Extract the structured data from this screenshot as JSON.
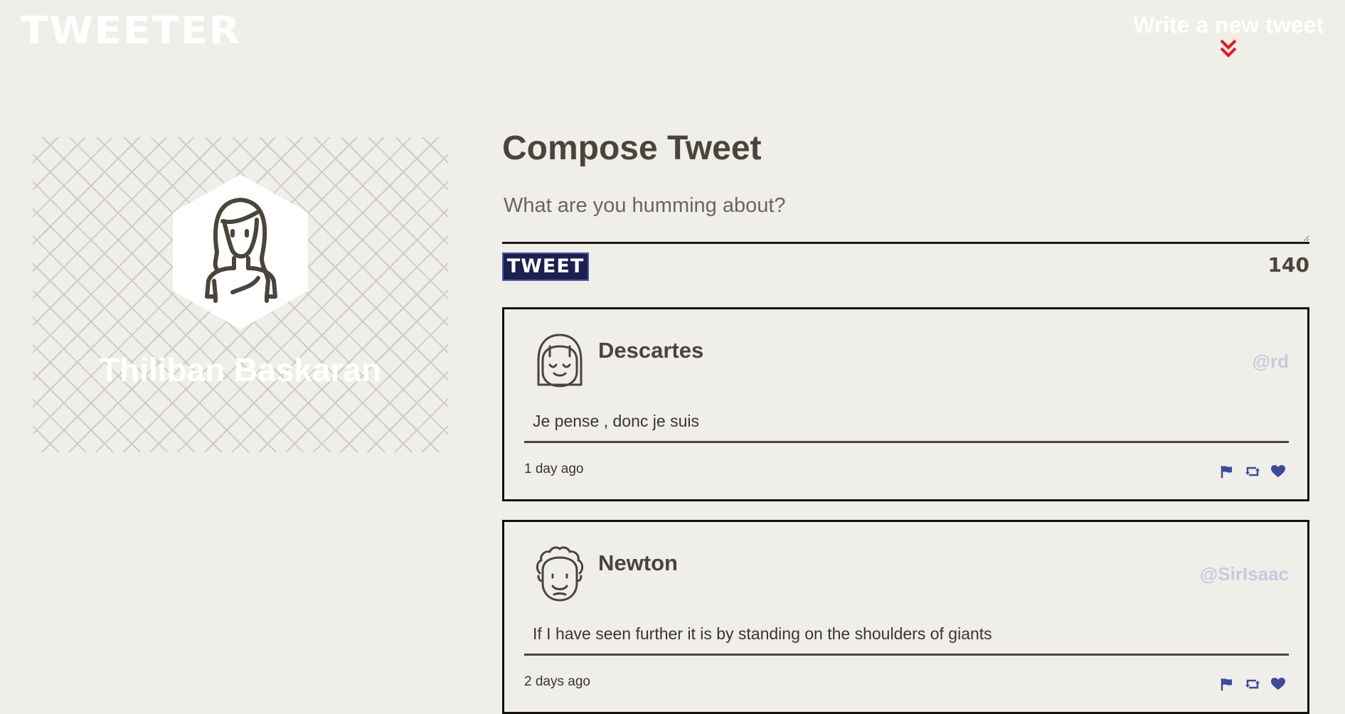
{
  "nav": {
    "logo": "TWEETER",
    "write_new_label": "Write a new tweet",
    "write_new_icon": "double-chevron-down-icon",
    "write_new_icon_color": "#e8141c"
  },
  "profile": {
    "name": "Thiliban Baskaran",
    "avatar_icon": "woman-avatar-icon"
  },
  "compose": {
    "title": "Compose Tweet",
    "placeholder": "What are you humming about?",
    "value": "",
    "button_label": "TWEET",
    "counter": "140"
  },
  "colors": {
    "background": "#f0eee8",
    "text": "#4a443c",
    "button_bg": "#1c1f4f",
    "icon_accent": "#3d4a9c",
    "handle": "#c7cae0"
  },
  "tweets": [
    {
      "name": "Descartes",
      "handle": "@rd",
      "text": "Je pense , donc je suis",
      "time": "1 day ago",
      "avatar_icon": "girl-avatar-icon",
      "actions": [
        "flag-icon",
        "retweet-icon",
        "heart-icon"
      ]
    },
    {
      "name": "Newton",
      "handle": "@SirIsaac",
      "text": "If I have seen further it is by standing on the shoulders of giants",
      "time": "2 days ago",
      "avatar_icon": "curly-hair-man-avatar-icon",
      "actions": [
        "flag-icon",
        "retweet-icon",
        "heart-icon"
      ]
    }
  ]
}
